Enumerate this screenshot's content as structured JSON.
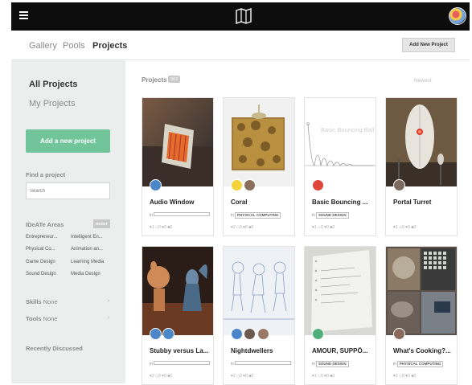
{
  "header": {
    "menu_icon": "hamburger-icon",
    "logo_icon": "map-logo-icon",
    "avatar": "user-avatar"
  },
  "subnav": {
    "tabs": [
      {
        "label": "Gallery"
      },
      {
        "label": "Pools"
      },
      {
        "label": "Projects"
      }
    ],
    "active_tab": "Projects",
    "add_button": "Add New Project"
  },
  "sidebar": {
    "all_projects": "All Projects",
    "my_projects": "My Projects",
    "add_button": "Add a new project",
    "find_label": "Find a project",
    "search_placeholder": "Search",
    "areas_label": "IDeATe Areas",
    "reset_label": "RESET",
    "areas": [
      "Entrepreneur...",
      "Intelligent En...",
      "Physical Co...",
      "Animation an...",
      "Game Design",
      "Learning Media",
      "Sound Design",
      "Media Design"
    ],
    "skills_label": "Skills",
    "skills_value": "None",
    "tools_label": "Tools",
    "tools_value": "None",
    "recent_label": "Recently Discussed"
  },
  "main": {
    "projects_label": "Projects",
    "projects_count": "563",
    "sort_label": "Newest",
    "cards": [
      {
        "title": "Audio Window",
        "in_label": "in",
        "tag": "",
        "stats": "♥1 ◇0 ♥0 ■0"
      },
      {
        "title": "Coral",
        "in_label": "in",
        "tag": "PHYSICAL COMPUTING",
        "stats": "♥2 ◇0 ♥0 ■0"
      },
      {
        "title": "Basic Bouncing ...",
        "in_label": "in",
        "tag": "SOUND DESIGN",
        "stats": "♥1 ◇0 ♥0 ■0",
        "thumb_text": "Basic Bouncing Ball"
      },
      {
        "title": "Portal Turret",
        "in_label": "",
        "tag": "",
        "stats": "♥1 ◇0 ♥0 ■0"
      },
      {
        "title": "Stubby versus La...",
        "in_label": "in",
        "tag": "",
        "stats": "♥2 ◇0 ♥0 ■0"
      },
      {
        "title": "Nightdwellers",
        "in_label": "in",
        "tag": "",
        "stats": "♥2 ◇0 ♥0 ■0"
      },
      {
        "title": "AMOUR, SUPPÔ...",
        "in_label": "in",
        "tag": "SOUND DESIGN",
        "stats": "♥1 ◇0 ♥0 ■0"
      },
      {
        "title": "What's Cooking?...",
        "in_label": "in",
        "tag": "PHYSICAL COMPUTING",
        "stats": "♥1 ◇0 ♥0 ■0"
      }
    ]
  },
  "colors": {
    "topbar": "#0d0d0d",
    "sidebar_bg": "#eceeed",
    "accent_green": "#72c59b",
    "avatar_blue": "#4a86c8"
  }
}
